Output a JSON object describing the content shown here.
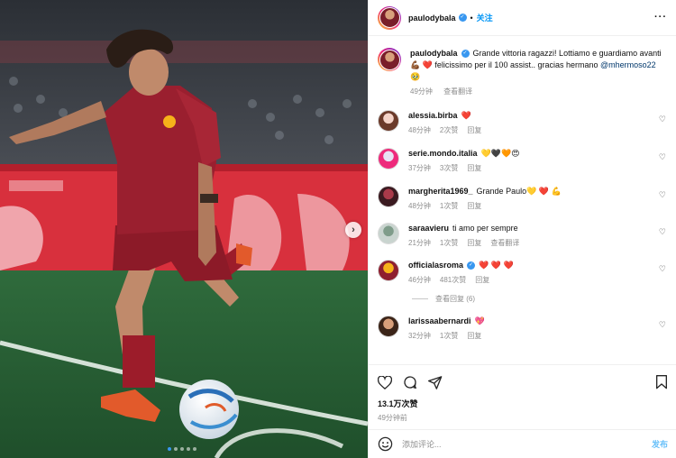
{
  "post": {
    "author": "paulodybala",
    "follow_label": "关注",
    "separator": "•",
    "more_label": "···",
    "caption_parts": [
      "Grande vittoria ragazzi! Lottiamo e guardiamo avanti 💪🏾 ❤️ felicissimo per il 100 assist.. gracias hermano ",
      "@mhermoso22",
      " 🥹"
    ],
    "caption_time": "49分钟",
    "translate_label": "查看翻译"
  },
  "comments": [
    {
      "user": "alessia.birba",
      "text": "❤️",
      "time": "48分钟",
      "likes": "2次赞",
      "reply": "回复",
      "translate": "",
      "avatar_colors": [
        "#f4d3c8",
        "#6b3a2a"
      ]
    },
    {
      "user": "serie.mondo.italia",
      "text": "💛🖤🧡😍",
      "time": "37分钟",
      "likes": "3次赞",
      "reply": "回复",
      "translate": "",
      "avatar_colors": [
        "#e8e2f4",
        "#ee2a7b"
      ]
    },
    {
      "user": "margherita1969_",
      "text": "Grande Paulo💛 ❤️ 💪",
      "time": "48分钟",
      "likes": "1次赞",
      "reply": "回复",
      "translate": "",
      "avatar_colors": [
        "#a93a4a",
        "#3a1a20"
      ]
    },
    {
      "user": "saraavieru",
      "text": "ti amo per sempre",
      "time": "21分钟",
      "likes": "1次赞",
      "reply": "回复",
      "translate": "查看翻译",
      "avatar_colors": [
        "#7f9c8a",
        "#c9d4cf"
      ]
    },
    {
      "user": "officialasroma",
      "text": "❤️ ❤️ ❤️",
      "time": "46分钟",
      "likes": "481次赞",
      "reply": "回复",
      "translate": "",
      "avatar_colors": [
        "#f6b21a",
        "#8e1f2f"
      ]
    },
    {
      "user": "larissaabernardi",
      "text": "💖",
      "time": "32分钟",
      "likes": "1次赞",
      "reply": "回复",
      "translate": "",
      "avatar_colors": [
        "#d89f7a",
        "#3b2418"
      ]
    }
  ],
  "view_replies": "查看回复 (6)",
  "likes_count": "13.1万次赞",
  "post_time": "49分钟前",
  "composer": {
    "placeholder": "添加评论...",
    "post_label": "发布"
  },
  "carousel": {
    "slide_count": 5,
    "active_index": 0,
    "next_icon": "›"
  },
  "colors": {
    "accent": "#0095f6",
    "verified": "#3897f0",
    "roma_red": "#8e1f2f"
  }
}
